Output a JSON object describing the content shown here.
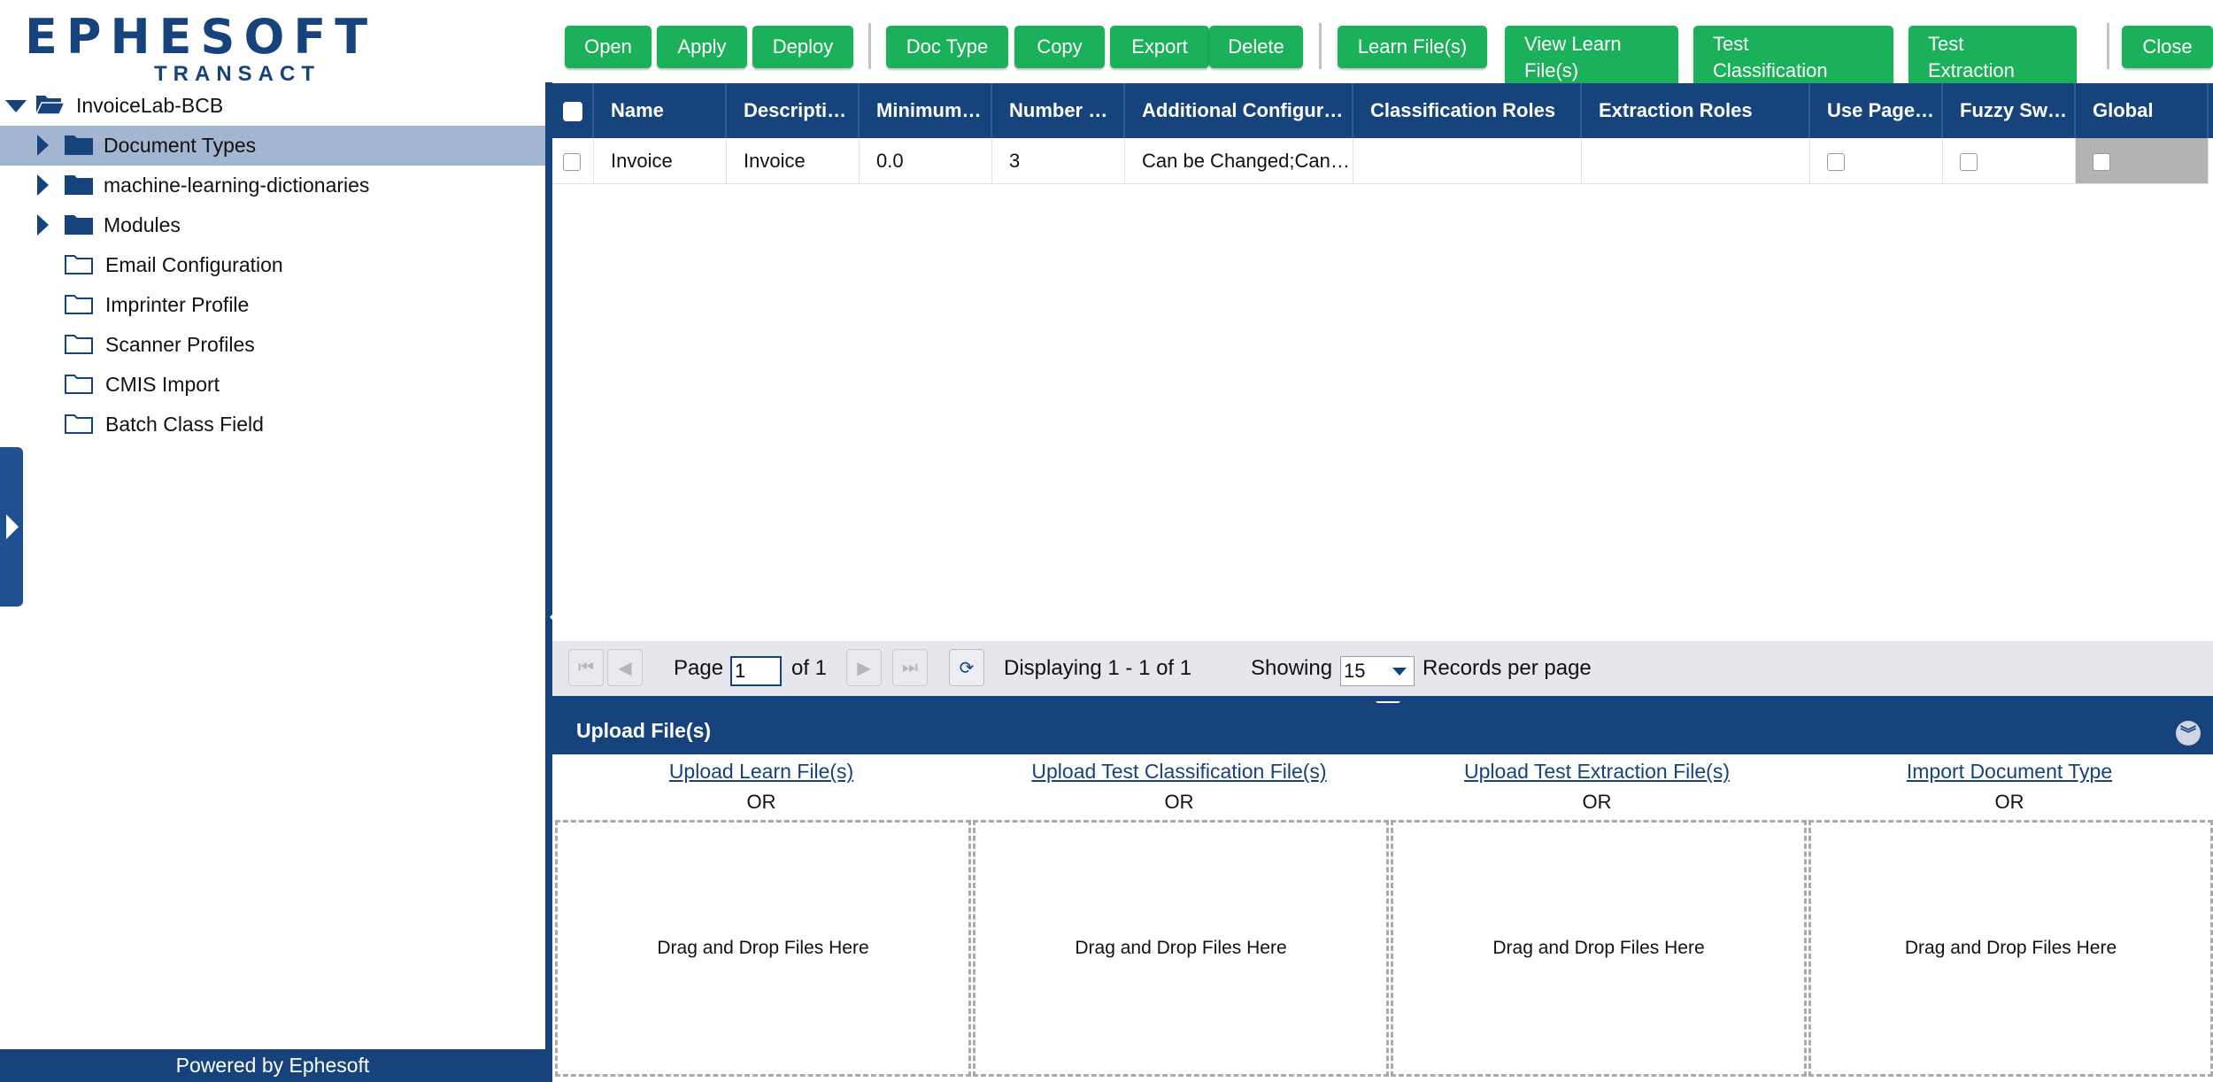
{
  "app": {
    "logo_main": "EPHESOFT",
    "logo_sub": "TRANSACT",
    "footer": "Powered by Ephesoft"
  },
  "tree": {
    "root": "InvoiceLab-BCB",
    "items": [
      {
        "label": "Document Types",
        "expandable": true,
        "filled": true,
        "selected": true
      },
      {
        "label": "machine-learning-dictionaries",
        "expandable": true,
        "filled": true,
        "selected": false
      },
      {
        "label": "Modules",
        "expandable": true,
        "filled": true,
        "selected": false
      },
      {
        "label": "Email Configuration",
        "expandable": false,
        "filled": false,
        "selected": false
      },
      {
        "label": "Imprinter Profile",
        "expandable": false,
        "filled": false,
        "selected": false
      },
      {
        "label": "Scanner Profiles",
        "expandable": false,
        "filled": false,
        "selected": false
      },
      {
        "label": "CMIS Import",
        "expandable": false,
        "filled": false,
        "selected": false
      },
      {
        "label": "Batch Class Field",
        "expandable": false,
        "filled": false,
        "selected": false
      }
    ]
  },
  "toolbar": {
    "open": "Open",
    "apply": "Apply",
    "deploy": "Deploy",
    "doc_type": "Doc Type",
    "copy": "Copy",
    "export": "Export",
    "delete": "Delete",
    "learn_files": "Learn File(s)",
    "view_learn_line1": "View Learn",
    "view_learn_line2": "File(s)",
    "test_class_line1": "Test",
    "test_class_line2": "Classification",
    "test_extract_line1": "Test",
    "test_extract_line2": "Extraction",
    "close": "Close"
  },
  "grid": {
    "columns": [
      "Name",
      "Descripti…",
      "Minimum…",
      "Number …",
      "Additional Configur…",
      "Classification Roles",
      "Extraction Roles",
      "Use Page…",
      "Fuzzy Sw…",
      "Global"
    ],
    "rows": [
      {
        "name": "Invoice",
        "description": "Invoice",
        "minimum": "0.0",
        "number": "3",
        "additional": "Can be Changed;Can…",
        "classification_roles": "",
        "extraction_roles": ""
      }
    ]
  },
  "pager": {
    "page_label": "Page",
    "page_value": "1",
    "of_label": "of 1",
    "displaying": "Displaying 1 - 1 of 1",
    "showing": "Showing",
    "records_value": "15",
    "records_label": "Records per page"
  },
  "upload": {
    "title": "Upload File(s)",
    "columns": [
      {
        "link": "Upload Learn File(s)",
        "or": "OR",
        "drop": "Drag and Drop Files Here"
      },
      {
        "link": "Upload Test Classification File(s)",
        "or": "OR",
        "drop": "Drag and Drop Files Here"
      },
      {
        "link": "Upload Test Extraction File(s)",
        "or": "OR",
        "drop": "Drag and Drop Files Here"
      },
      {
        "link": "Import Document Type",
        "or": "OR",
        "drop": "Drag and Drop Files Here"
      }
    ]
  },
  "colors": {
    "brand_blue": "#17437d",
    "button_green": "#1bb05a",
    "selection": "#a3b6d1"
  }
}
